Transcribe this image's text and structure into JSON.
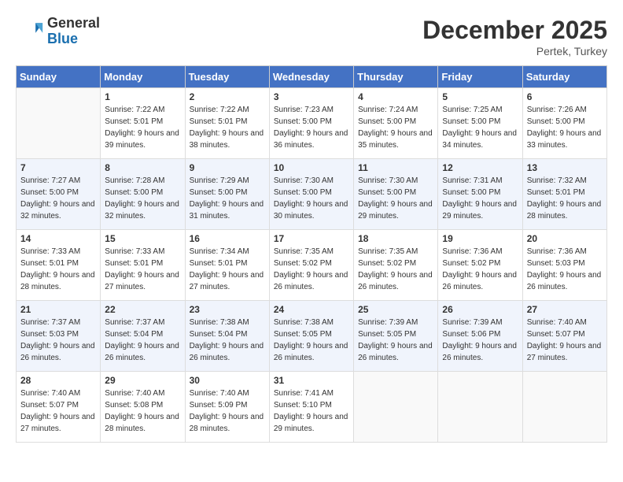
{
  "header": {
    "logo_general": "General",
    "logo_blue": "Blue",
    "month": "December 2025",
    "location": "Pertek, Turkey"
  },
  "days_of_week": [
    "Sunday",
    "Monday",
    "Tuesday",
    "Wednesday",
    "Thursday",
    "Friday",
    "Saturday"
  ],
  "weeks": [
    [
      null,
      {
        "day": "1",
        "sunrise": "7:22 AM",
        "sunset": "5:01 PM",
        "daylight": "9 hours and 39 minutes."
      },
      {
        "day": "2",
        "sunrise": "7:22 AM",
        "sunset": "5:01 PM",
        "daylight": "9 hours and 38 minutes."
      },
      {
        "day": "3",
        "sunrise": "7:23 AM",
        "sunset": "5:00 PM",
        "daylight": "9 hours and 36 minutes."
      },
      {
        "day": "4",
        "sunrise": "7:24 AM",
        "sunset": "5:00 PM",
        "daylight": "9 hours and 35 minutes."
      },
      {
        "day": "5",
        "sunrise": "7:25 AM",
        "sunset": "5:00 PM",
        "daylight": "9 hours and 34 minutes."
      },
      {
        "day": "6",
        "sunrise": "7:26 AM",
        "sunset": "5:00 PM",
        "daylight": "9 hours and 33 minutes."
      }
    ],
    [
      {
        "day": "7",
        "sunrise": "7:27 AM",
        "sunset": "5:00 PM",
        "daylight": "9 hours and 32 minutes."
      },
      {
        "day": "8",
        "sunrise": "7:28 AM",
        "sunset": "5:00 PM",
        "daylight": "9 hours and 32 minutes."
      },
      {
        "day": "9",
        "sunrise": "7:29 AM",
        "sunset": "5:00 PM",
        "daylight": "9 hours and 31 minutes."
      },
      {
        "day": "10",
        "sunrise": "7:30 AM",
        "sunset": "5:00 PM",
        "daylight": "9 hours and 30 minutes."
      },
      {
        "day": "11",
        "sunrise": "7:30 AM",
        "sunset": "5:00 PM",
        "daylight": "9 hours and 29 minutes."
      },
      {
        "day": "12",
        "sunrise": "7:31 AM",
        "sunset": "5:00 PM",
        "daylight": "9 hours and 29 minutes."
      },
      {
        "day": "13",
        "sunrise": "7:32 AM",
        "sunset": "5:01 PM",
        "daylight": "9 hours and 28 minutes."
      }
    ],
    [
      {
        "day": "14",
        "sunrise": "7:33 AM",
        "sunset": "5:01 PM",
        "daylight": "9 hours and 28 minutes."
      },
      {
        "day": "15",
        "sunrise": "7:33 AM",
        "sunset": "5:01 PM",
        "daylight": "9 hours and 27 minutes."
      },
      {
        "day": "16",
        "sunrise": "7:34 AM",
        "sunset": "5:01 PM",
        "daylight": "9 hours and 27 minutes."
      },
      {
        "day": "17",
        "sunrise": "7:35 AM",
        "sunset": "5:02 PM",
        "daylight": "9 hours and 26 minutes."
      },
      {
        "day": "18",
        "sunrise": "7:35 AM",
        "sunset": "5:02 PM",
        "daylight": "9 hours and 26 minutes."
      },
      {
        "day": "19",
        "sunrise": "7:36 AM",
        "sunset": "5:02 PM",
        "daylight": "9 hours and 26 minutes."
      },
      {
        "day": "20",
        "sunrise": "7:36 AM",
        "sunset": "5:03 PM",
        "daylight": "9 hours and 26 minutes."
      }
    ],
    [
      {
        "day": "21",
        "sunrise": "7:37 AM",
        "sunset": "5:03 PM",
        "daylight": "9 hours and 26 minutes."
      },
      {
        "day": "22",
        "sunrise": "7:37 AM",
        "sunset": "5:04 PM",
        "daylight": "9 hours and 26 minutes."
      },
      {
        "day": "23",
        "sunrise": "7:38 AM",
        "sunset": "5:04 PM",
        "daylight": "9 hours and 26 minutes."
      },
      {
        "day": "24",
        "sunrise": "7:38 AM",
        "sunset": "5:05 PM",
        "daylight": "9 hours and 26 minutes."
      },
      {
        "day": "25",
        "sunrise": "7:39 AM",
        "sunset": "5:05 PM",
        "daylight": "9 hours and 26 minutes."
      },
      {
        "day": "26",
        "sunrise": "7:39 AM",
        "sunset": "5:06 PM",
        "daylight": "9 hours and 26 minutes."
      },
      {
        "day": "27",
        "sunrise": "7:40 AM",
        "sunset": "5:07 PM",
        "daylight": "9 hours and 27 minutes."
      }
    ],
    [
      {
        "day": "28",
        "sunrise": "7:40 AM",
        "sunset": "5:07 PM",
        "daylight": "9 hours and 27 minutes."
      },
      {
        "day": "29",
        "sunrise": "7:40 AM",
        "sunset": "5:08 PM",
        "daylight": "9 hours and 28 minutes."
      },
      {
        "day": "30",
        "sunrise": "7:40 AM",
        "sunset": "5:09 PM",
        "daylight": "9 hours and 28 minutes."
      },
      {
        "day": "31",
        "sunrise": "7:41 AM",
        "sunset": "5:10 PM",
        "daylight": "9 hours and 29 minutes."
      },
      null,
      null,
      null
    ]
  ],
  "labels": {
    "sunrise": "Sunrise:",
    "sunset": "Sunset:",
    "daylight": "Daylight:"
  }
}
